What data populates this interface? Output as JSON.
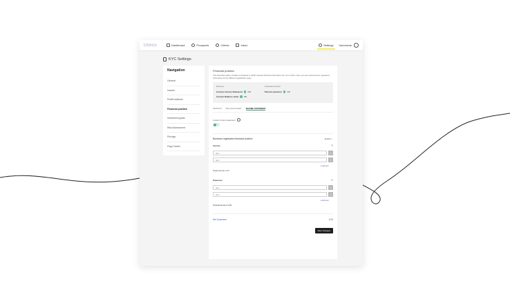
{
  "topbar": {
    "logo": "Unnco",
    "nav": [
      "Dashboard",
      "Prospects",
      "Clients",
      "Inbox"
    ],
    "settings_label": "Settings",
    "user_name": "Username"
  },
  "page": {
    "title": "KYC Settings"
  },
  "sidebar": {
    "heading": "Navigation",
    "items": [
      {
        "label": "General"
      },
      {
        "label": "Income"
      },
      {
        "label": "Profile address"
      },
      {
        "label": "Financial position"
      },
      {
        "label": "Investment goals"
      },
      {
        "label": "Risk Assessment"
      },
      {
        "label": "Pricings"
      },
      {
        "label": "Flag Creator"
      }
    ]
  },
  "main": {
    "title": "Financial position",
    "description": "The financial position module is designed to obtain relevant financial information from your client. Here you can customize fee requested information for the different registration types.",
    "info": {
      "business_label": "Business",
      "business_rows": [
        {
          "key": "Custom Income Statement",
          "val": "ON"
        },
        {
          "key": "Custom Balance sheet",
          "val": "ON"
        }
      ],
      "individual_label": "Individual and joint",
      "individual_rows": [
        {
          "key": "Pension question",
          "val": "OK"
        }
      ]
    },
    "tabs": [
      "PENSION",
      "BALANCE SHEET",
      "INCOME STATEMENT"
    ],
    "toggle_label": "Custom income statement",
    "section_title": "Business registration financial position",
    "language": "English",
    "income": {
      "title": "Income",
      "fields": [
        "Item",
        "Item"
      ],
      "add_label": "+ Add item",
      "total_label": "Total Income",
      "total_value": "0.00"
    },
    "expenses": {
      "title": "Expenses",
      "fields": [
        "Item",
        "Item"
      ],
      "add_label": "+ Add item",
      "total_label": "Total Expenses",
      "total_value": "0.00"
    },
    "net_label": "Net Expenses",
    "net_value": "0.00",
    "save_label": "Save Changes"
  },
  "colors": {
    "accent_green": "#4db388",
    "link_blue": "#4a67b8",
    "highlight_yellow": "#f4ec5a"
  }
}
